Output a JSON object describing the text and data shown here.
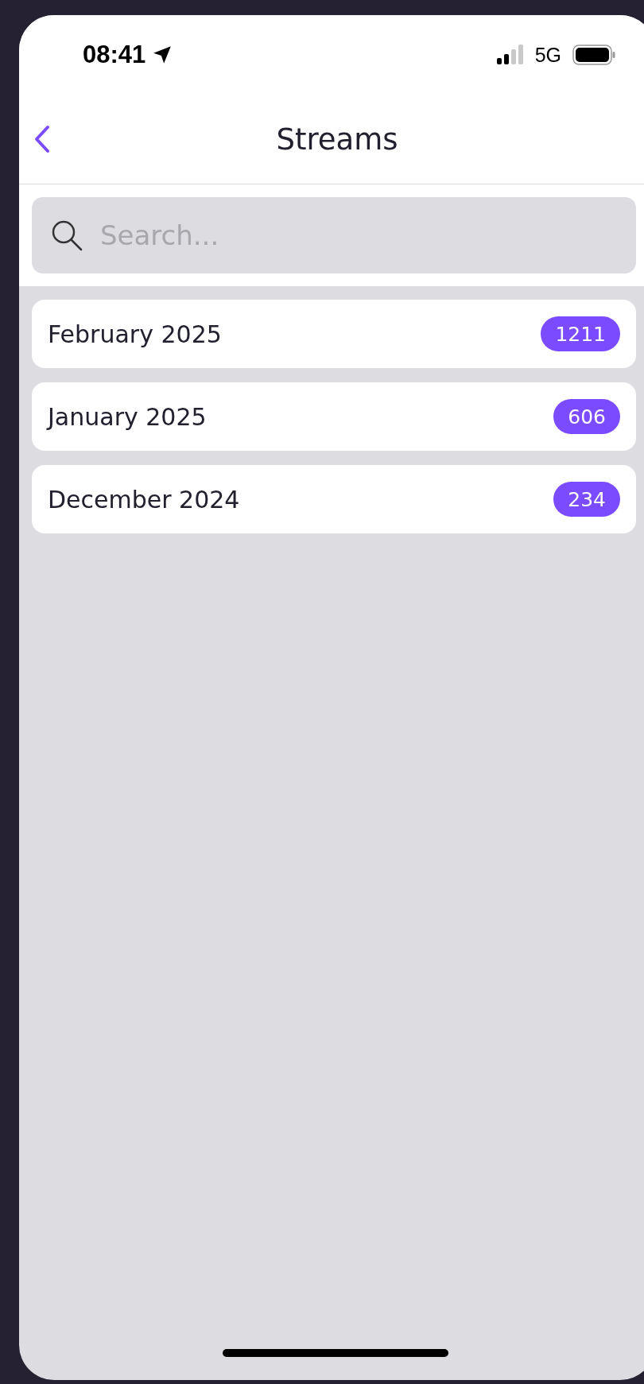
{
  "status_bar": {
    "time": "08:41",
    "network": "5G"
  },
  "nav": {
    "title": "Streams"
  },
  "search": {
    "placeholder": "Search..."
  },
  "streams": [
    {
      "label": "February 2025",
      "count": "1211"
    },
    {
      "label": "January 2025",
      "count": "606"
    },
    {
      "label": "December 2024",
      "count": "234"
    }
  ]
}
